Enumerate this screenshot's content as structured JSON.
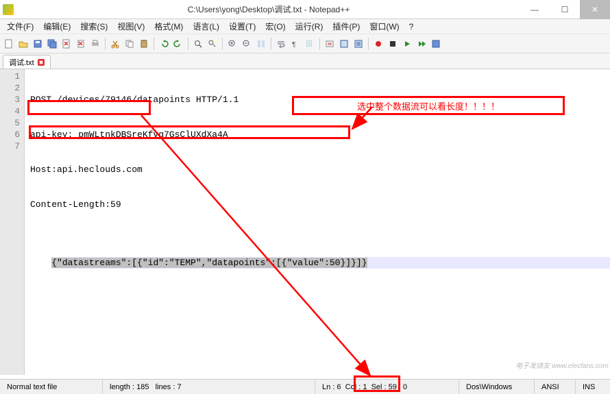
{
  "window": {
    "title": "C:\\Users\\yong\\Desktop\\调试.txt - Notepad++"
  },
  "menu": [
    "文件(F)",
    "编辑(E)",
    "搜索(S)",
    "视图(V)",
    "格式(M)",
    "语言(L)",
    "设置(T)",
    "宏(O)",
    "运行(R)",
    "插件(P)",
    "窗口(W)",
    "?"
  ],
  "tab": {
    "name": "调试.txt"
  },
  "lines": [
    "POST /devices/79146/datapoints HTTP/1.1",
    "api-key: pmWLtnkDBSreKfvg7GsClUXdXa4A",
    "Host:api.heclouds.com",
    "Content-Length:59",
    "",
    "{\"datastreams\":[{\"id\":\"TEMP\",\"datapoints\":[{\"value\":50}]}]}",
    ""
  ],
  "line_numbers": [
    "1",
    "2",
    "3",
    "4",
    "5",
    "6",
    "7"
  ],
  "annotation": {
    "callout": "选中整个数据流可以看长度！！！！"
  },
  "status": {
    "filetype": "Normal text file",
    "length_label": "length : 185",
    "lines_label": "lines : 7",
    "ln": "Ln : 6",
    "col": "Col : 1",
    "sel": "Sel : 59 | 0",
    "eol": "Dos\\Windows",
    "enc": "ANSI",
    "mode": "INS"
  },
  "watermark": "电子发烧友 www.elecfans.com"
}
